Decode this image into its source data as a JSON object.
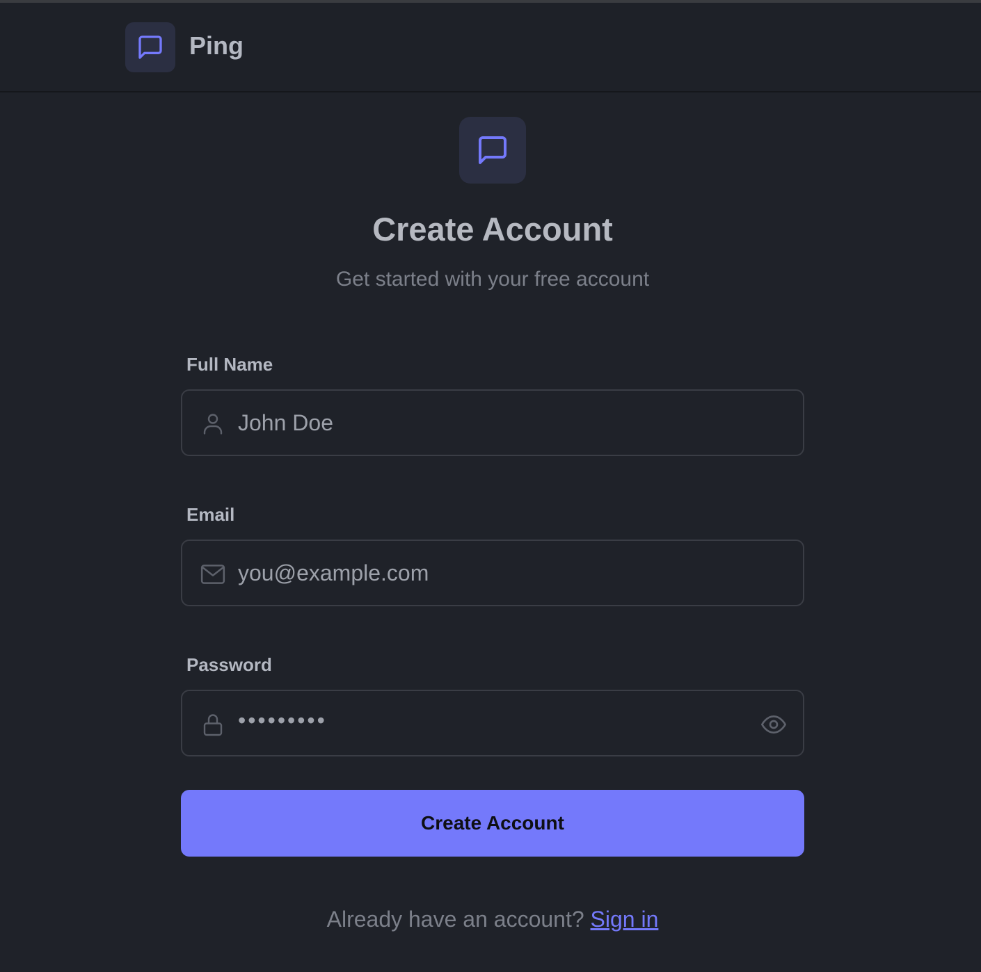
{
  "header": {
    "brand": "Ping",
    "logo_icon": "message-square-icon"
  },
  "hero": {
    "icon": "message-square-icon",
    "title": "Create Account",
    "subtitle": "Get started with your free account"
  },
  "form": {
    "full_name": {
      "label": "Full Name",
      "value": "John Doe",
      "icon": "user-icon"
    },
    "email": {
      "label": "Email",
      "value": "you@example.com",
      "icon": "mail-icon"
    },
    "password": {
      "label": "Password",
      "value": "•••••••••",
      "icon": "lock-icon",
      "toggle_icon": "eye-icon"
    },
    "submit_label": "Create Account"
  },
  "footer": {
    "prompt": "Already have an account?",
    "link": "Sign in"
  },
  "colors": {
    "background": "#1f2229",
    "accent": "#7479fb",
    "tile": "#2b2f42",
    "text_primary": "#b4b8c2",
    "text_muted": "#7c808a"
  }
}
